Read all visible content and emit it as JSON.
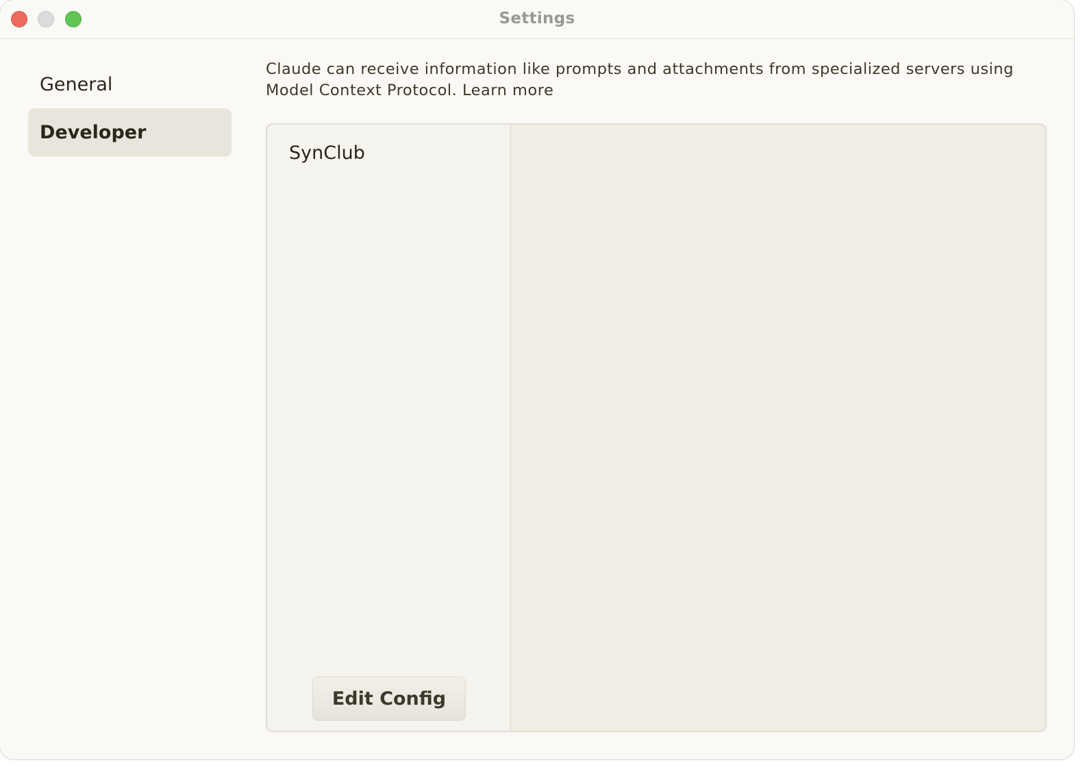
{
  "window": {
    "title": "Settings"
  },
  "sidebar": {
    "items": [
      {
        "label": "General",
        "selected": false
      },
      {
        "label": "Developer",
        "selected": true
      }
    ]
  },
  "main": {
    "description": "Claude can receive information like prompts and attachments from specialized servers using Model Context Protocol.",
    "learn_more": "Learn more",
    "servers": [
      {
        "name": "SynClub"
      }
    ],
    "edit_config_label": "Edit Config"
  },
  "colors": {
    "background": "#faf9f5",
    "selected_nav": "#e8e6dc",
    "panel_left": "#f5f4ef",
    "panel_right": "#f0ede5",
    "text": "#29261b",
    "close": "#ec6a5e",
    "minimize": "#dcdcdc",
    "zoom": "#61c554"
  }
}
